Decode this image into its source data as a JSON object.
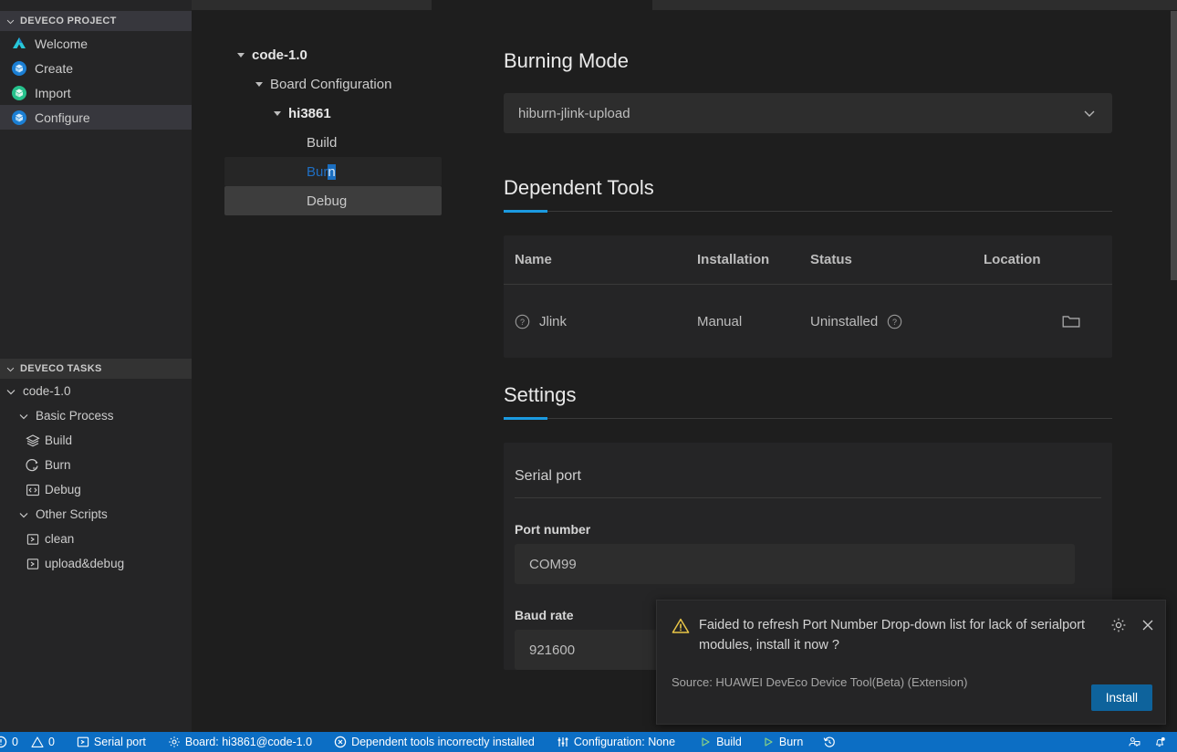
{
  "sidebar": {
    "project_section": {
      "title": "DEVECO PROJECT",
      "chevron": "chevron-down-icon",
      "items": [
        {
          "label": "Welcome",
          "icon": "welcome-logo-icon",
          "selected": false
        },
        {
          "label": "Create",
          "icon": "create-cube-icon",
          "selected": false
        },
        {
          "label": "Import",
          "icon": "import-cube-icon",
          "selected": false
        },
        {
          "label": "Configure",
          "icon": "configure-cube-icon",
          "selected": true
        }
      ]
    },
    "tasks_section": {
      "title": "DEVECO TASKS",
      "chevron": "chevron-down-icon",
      "items": [
        {
          "label": "code-1.0",
          "icon": "chevron-down-icon",
          "indent": 0
        },
        {
          "label": "Basic Process",
          "icon": "chevron-down-icon",
          "indent": 1
        },
        {
          "label": "Build",
          "icon": "layers-icon",
          "indent": 2
        },
        {
          "label": "Burn",
          "icon": "burn-icon",
          "indent": 2
        },
        {
          "label": "Debug",
          "icon": "code-brackets-icon",
          "indent": 2
        },
        {
          "label": "Other Scripts",
          "icon": "chevron-down-icon",
          "indent": 1
        },
        {
          "label": "clean",
          "icon": "terminal-icon",
          "indent": 2
        },
        {
          "label": "upload&debug",
          "icon": "terminal-icon",
          "indent": 2
        }
      ]
    }
  },
  "nav_tree": [
    {
      "label": "code-1.0",
      "level": 0,
      "caret": "caret-down-icon",
      "state": "normal"
    },
    {
      "label": "Board Configuration",
      "level": 1,
      "caret": "caret-down-icon",
      "state": "normal"
    },
    {
      "label": "hi3861",
      "level": 2,
      "caret": "caret-down-icon",
      "state": "normal"
    },
    {
      "label": "Build",
      "level": 3,
      "caret": "none",
      "state": "normal"
    },
    {
      "label": "Burn",
      "level": 3,
      "caret": "none",
      "state": "selected",
      "text_prefix": "Bur",
      "text_highlight": "n"
    },
    {
      "label": "Debug",
      "level": 3,
      "caret": "none",
      "state": "hover"
    }
  ],
  "main": {
    "burning_mode": {
      "title": "Burning Mode",
      "value": "hiburn-jlink-upload",
      "chevron": "chevron-down-icon"
    },
    "dependent_tools": {
      "title": "Dependent Tools",
      "columns": [
        "Name",
        "Installation",
        "Status",
        "Location"
      ],
      "rows": [
        {
          "name": "Jlink",
          "name_icon": "question-circle-icon",
          "installation": "Manual",
          "status": "Uninstalled",
          "status_icon": "question-circle-icon",
          "location": "",
          "location_icon": "folder-icon"
        }
      ]
    },
    "settings": {
      "title": "Settings",
      "group_title": "Serial port",
      "fields": [
        {
          "label": "Port number",
          "value": "COM99",
          "chevron": "chevron-down-icon"
        },
        {
          "label": "Baud rate",
          "value": "921600",
          "chevron": "chevron-down-icon"
        }
      ]
    }
  },
  "notification": {
    "warning_icon": "warning-triangle-icon",
    "message": "Faided to refresh Port Number Drop-down list for lack of serialport modules, install it now ?",
    "source": "Source: HUAWEI DevEco Device Tool(Beta) (Extension)",
    "settings_icon": "gear-icon",
    "close_icon": "close-icon",
    "primary_button": "Install",
    "accent_color": "#0e639c"
  },
  "statusbar": {
    "background": "#0c6ec4",
    "left_items": [
      {
        "label": "0",
        "icon": "error-circle-icon"
      },
      {
        "label": "0",
        "icon": "warning-triangle-icon"
      },
      {
        "label": "Serial port",
        "icon": "terminal-icon"
      },
      {
        "label": "Board: hi3861@code-1.0",
        "icon": "gear-icon"
      },
      {
        "label": "Dependent tools incorrectly installed",
        "icon": "error-circle-x-icon"
      },
      {
        "label": "Configuration: None",
        "icon": "sliders-icon"
      },
      {
        "label": "Build",
        "icon": "play-icon"
      },
      {
        "label": "Burn",
        "icon": "play-icon"
      },
      {
        "label": "",
        "icon": "history-icon"
      }
    ],
    "right_items": [
      {
        "label": "",
        "icon": "feedback-person-icon"
      },
      {
        "label": "",
        "icon": "bell-dot-icon"
      }
    ]
  }
}
